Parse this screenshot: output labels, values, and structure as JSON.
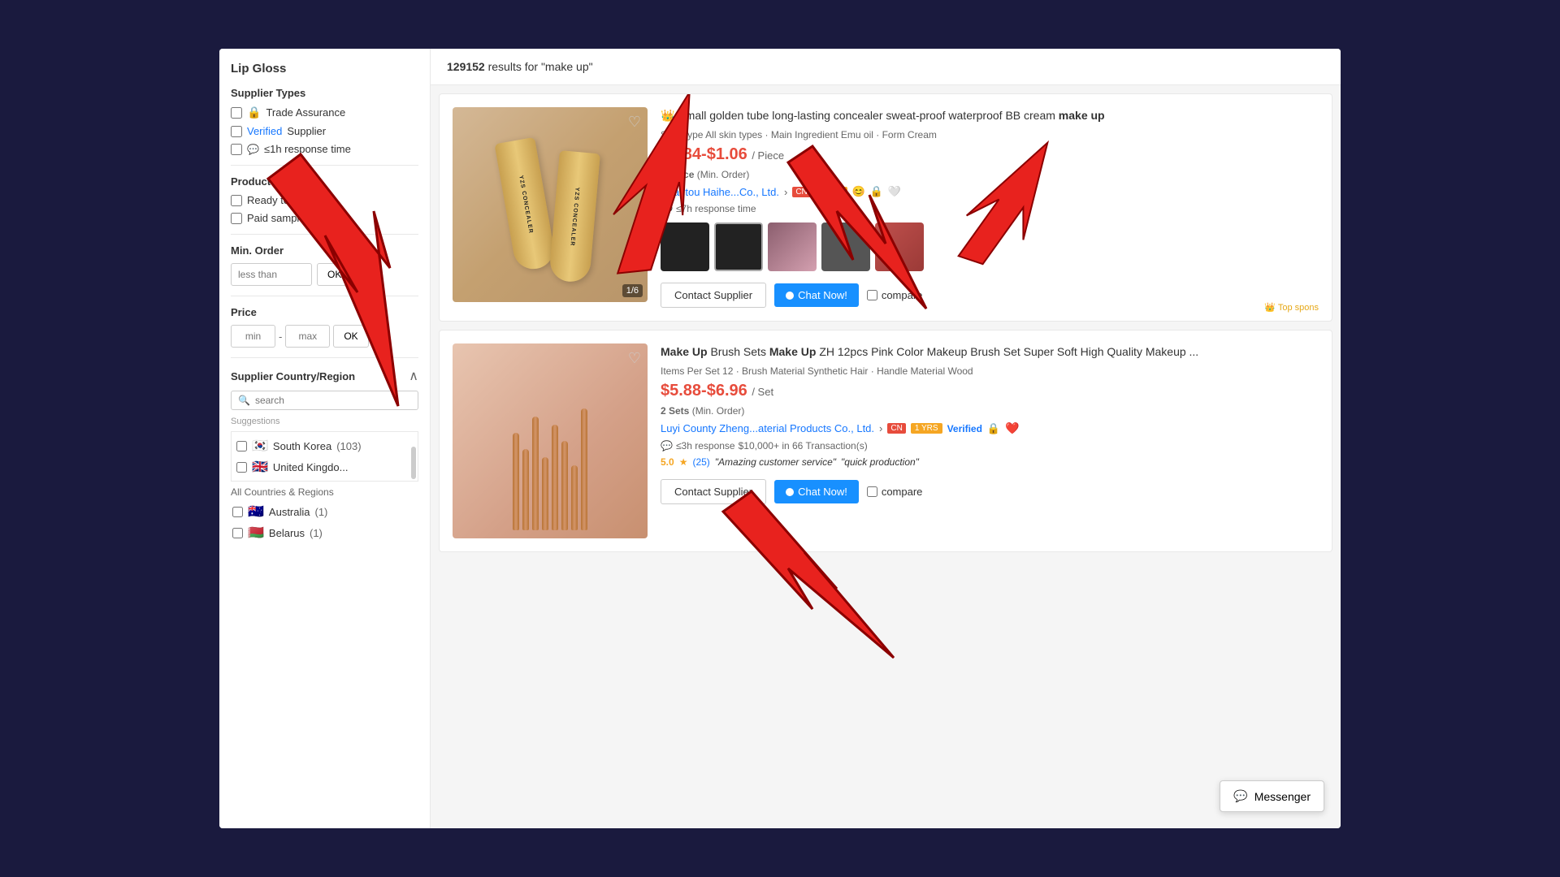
{
  "page": {
    "background_color": "#1a1a3e"
  },
  "sidebar": {
    "title": "Lip Gloss",
    "supplier_types": {
      "label": "Supplier Types",
      "options": [
        {
          "id": "trade-assurance",
          "label": "Trade Assurance",
          "icon": "🔒",
          "checked": false
        },
        {
          "id": "verified-supplier",
          "label": "Supplier",
          "prefix": "Verified",
          "checked": false
        },
        {
          "id": "response-time",
          "label": "≤1h response time",
          "checked": false
        }
      ]
    },
    "product_types": {
      "label": "Product Types",
      "options": [
        {
          "id": "ready-to-ship",
          "label": "Ready to Ship",
          "checked": false
        },
        {
          "id": "paid-samples",
          "label": "Paid samples",
          "checked": false
        }
      ]
    },
    "min_order": {
      "label": "Min. Order",
      "placeholder": "less than",
      "ok_label": "OK"
    },
    "price": {
      "label": "Price",
      "min_placeholder": "min",
      "max_placeholder": "max",
      "ok_label": "OK"
    },
    "supplier_country": {
      "label": "Supplier Country/Region",
      "search_placeholder": "search",
      "suggestions_label": "Suggestions",
      "suggestions": [
        {
          "flag": "🇰🇷",
          "name": "South Korea",
          "count": "(103)"
        },
        {
          "flag": "🇬🇧",
          "name": "United Kingdo...",
          "count": ""
        }
      ],
      "all_countries_label": "All Countries & Regions",
      "all_countries": [
        {
          "flag": "🇦🇺",
          "name": "Australia",
          "count": "(1)"
        },
        {
          "flag": "🇧🇾",
          "name": "Belarus",
          "count": "(1)"
        }
      ]
    }
  },
  "results": {
    "count": "129152",
    "query": "make up",
    "results_text": "results for \"make up\""
  },
  "products": [
    {
      "id": "product-1",
      "crown": "👑",
      "title_start": "Small golden tube long-lasting concealer sweat-proof waterproof BB cream ",
      "title_bold": "make up",
      "meta": "Skin Type All skin types · Main Ingredient Emu oil · Form Cream",
      "price": "$0.84-$1.06",
      "per_unit": "/ Piece",
      "min_order": "1 Piece",
      "min_order_suffix": "(Min. Order)",
      "supplier_name": "Shantou Haihе...Co., Ltd.",
      "supplier_country": "CN",
      "supplier_years": "1 YRS",
      "response_time": "≤7h response time",
      "image_counter": "1/6",
      "contact_label": "Contact Supplier",
      "chat_label": "Chat Now!",
      "chat_icon": "💬",
      "compare_label": "compare",
      "top_sponsor": "Top spons",
      "top_sponsor_icon": "👑"
    },
    {
      "id": "product-2",
      "title_part1": "Make Up",
      "title_mid": " Brush Sets ",
      "title_bold": "Make Up",
      "title_end": " ZH 12pcs Pink Color Makeup Brush Set Super Soft High Quality Makeup ...",
      "meta": "Items Per Set 12 · Brush Material Synthetic Hair · Handle Material Wood",
      "price": "$5.88-$6.96",
      "per_unit": "/ Set",
      "min_order": "2 Sets",
      "min_order_suffix": "(Min. Order)",
      "supplier_name": "Luyi County Zheng...aterial Products Co., Ltd.",
      "supplier_country": "CN",
      "supplier_years": "1 YRS",
      "verified_badge": "Verified",
      "response_time": "≤3h response",
      "transactions": "$10,000+ in 66 Transaction(s)",
      "rating": "5.0",
      "rating_star": "★",
      "review_count": "(25)",
      "review_quote1": "\"Amazing customer service\"",
      "review_quote2": "\"quick production\"",
      "contact_label": "Contact Supplier",
      "chat_label": "Chat Now!",
      "compare_label": "compare"
    }
  ],
  "messenger": {
    "label": "Messenger",
    "icon": "💬"
  }
}
